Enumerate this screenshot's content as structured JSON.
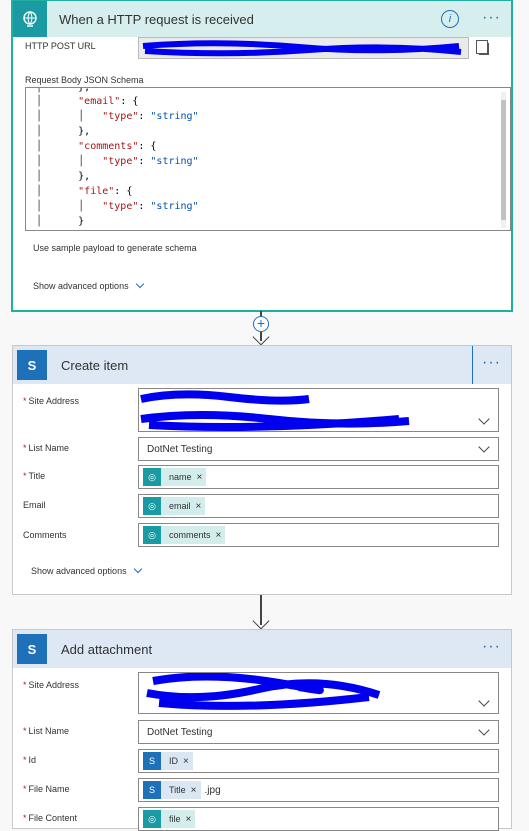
{
  "trigger": {
    "title": "When a HTTP request is received",
    "http_post_url_label": "HTTP POST URL",
    "schema_label": "Request Body JSON Schema",
    "schema_lines": [
      {
        "indent": "    ",
        "text": "},"
      },
      {
        "indent": "    ",
        "key": "\"email\"",
        "rest": ": {"
      },
      {
        "indent": "        ",
        "key2": "\"type\"",
        "rest2": ": ",
        "val": "\"string\""
      },
      {
        "indent": "    ",
        "text": "},"
      },
      {
        "indent": "    ",
        "key": "\"comments\"",
        "rest": ": {"
      },
      {
        "indent": "        ",
        "key2": "\"type\"",
        "rest2": ": ",
        "val": "\"string\""
      },
      {
        "indent": "    ",
        "text": "},"
      },
      {
        "indent": "    ",
        "key": "\"file\"",
        "rest": ": {"
      },
      {
        "indent": "        ",
        "key2": "\"type\"",
        "rest2": ": ",
        "val": "\"string\""
      },
      {
        "indent": "    ",
        "text": "}"
      }
    ],
    "sample_payload_link": "Use sample payload to generate schema",
    "advanced_options": "Show advanced options"
  },
  "create_item": {
    "title": "Create item",
    "site_address_label": "Site Address",
    "list_name_label": "List Name",
    "list_name_value": "DotNet Testing",
    "title_label": "Title",
    "title_token": "name",
    "email_label": "Email",
    "email_token": "email",
    "comments_label": "Comments",
    "comments_token": "comments",
    "advanced_options": "Show advanced options"
  },
  "add_attachment": {
    "title": "Add attachment",
    "site_address_label": "Site Address",
    "list_name_label": "List Name",
    "list_name_value": "DotNet Testing",
    "id_label": "Id",
    "id_token": "ID",
    "file_name_label": "File Name",
    "file_name_token": "Title",
    "file_name_suffix": ".jpg",
    "file_content_label": "File Content",
    "file_content_token": "file"
  },
  "icons": {
    "trigger": "http-request-icon",
    "sharepoint": "sharepoint-icon",
    "more": "more-options-icon",
    "info": "info-icon",
    "copy": "copy-icon",
    "remove": "remove-token-icon"
  },
  "colors": {
    "accent": "#1e71b8",
    "teal": "#1a9ba3",
    "redaction": "#0000ee"
  },
  "glyphs": {
    "more": "···",
    "info": "i",
    "remove": "×",
    "required": "*",
    "add": "+",
    "sp": "S"
  }
}
